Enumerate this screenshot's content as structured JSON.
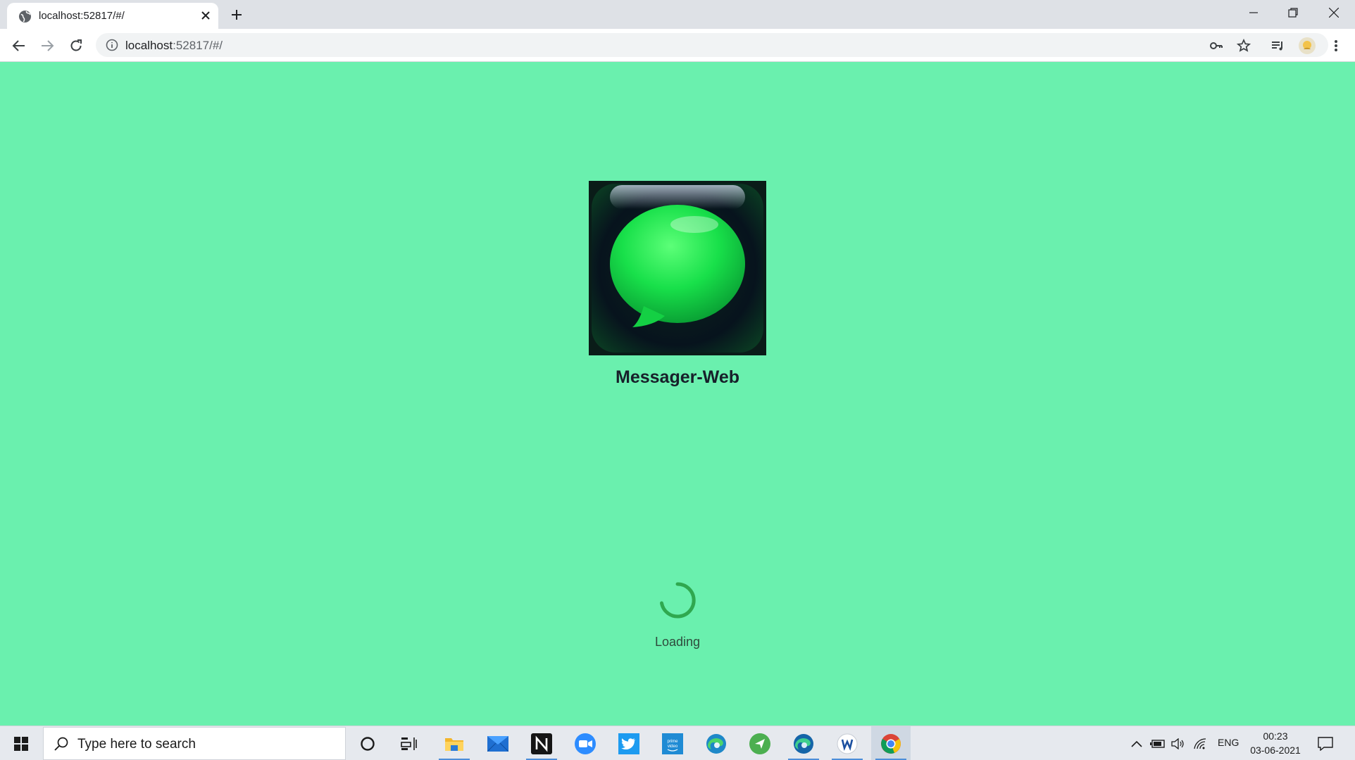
{
  "browser": {
    "tab": {
      "title": "localhost:52817/#/",
      "favicon": "globe-icon"
    },
    "new_tab_icon": "plus-icon",
    "window_controls": [
      "minimize-icon",
      "restore-icon",
      "close-icon"
    ],
    "toolbar": {
      "back_icon": "arrow-left-icon",
      "forward_icon": "arrow-right-icon",
      "reload_icon": "reload-icon",
      "omnibox": {
        "host": "localhost",
        "path": ":52817/#/",
        "info_icon": "info-icon"
      },
      "right_icons": [
        "key-icon",
        "star-icon",
        "reading-list-icon",
        "profile-avatar",
        "kebab-menu-icon"
      ]
    }
  },
  "app": {
    "logo_icon": "chat-bubble-app-icon",
    "name": "Messager-Web",
    "loading_text": "Loading",
    "colors": {
      "background": "#6af0ae",
      "spinner": "#2fa84f"
    }
  },
  "taskbar": {
    "start_icon": "windows-logo-icon",
    "search_placeholder": "Type here to search",
    "pinned_apps": [
      {
        "name": "cortana-circle-icon"
      },
      {
        "name": "task-view-icon"
      },
      {
        "name": "file-explorer-icon"
      },
      {
        "name": "mail-icon"
      },
      {
        "name": "notion-icon"
      },
      {
        "name": "zoom-icon"
      },
      {
        "name": "twitter-icon"
      },
      {
        "name": "prime-video-icon",
        "label": "prime video"
      },
      {
        "name": "edge-icon"
      },
      {
        "name": "send-app-icon"
      },
      {
        "name": "edge-dev-icon"
      },
      {
        "name": "word-app-icon"
      },
      {
        "name": "chrome-icon"
      }
    ],
    "tray": {
      "icons": [
        "chevron-up-icon",
        "battery-icon",
        "volume-icon",
        "wifi-icon"
      ],
      "language": "ENG",
      "time": "00:23",
      "date": "03-06-2021",
      "notification_icon": "action-center-icon"
    }
  }
}
